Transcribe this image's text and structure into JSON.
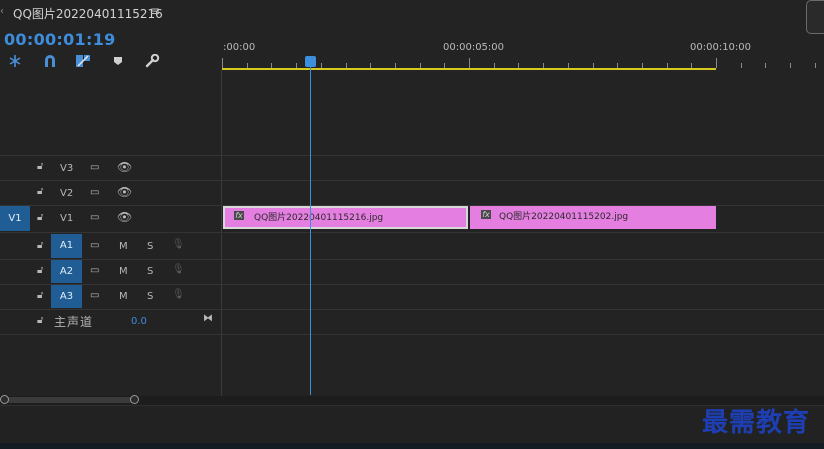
{
  "sequence": {
    "tab_title": "QQ图片20220401115216",
    "tab_arrow": "‹",
    "menu_icon": "≡",
    "timecode": "00:00:01:19"
  },
  "ruler": {
    "labels": [
      ":00:00",
      "00:00:05:00",
      "00:00:10:00"
    ]
  },
  "tracks": {
    "video": [
      {
        "name": "V3",
        "source_patch": ""
      },
      {
        "name": "V2",
        "source_patch": ""
      },
      {
        "name": "V1",
        "source_patch": "V1"
      }
    ],
    "audio": [
      {
        "name": "A1",
        "mute": "M",
        "solo": "S"
      },
      {
        "name": "A2",
        "mute": "M",
        "solo": "S"
      },
      {
        "name": "A3",
        "mute": "M",
        "solo": "S"
      }
    ],
    "master": {
      "label": "主声道",
      "value": "0.0"
    }
  },
  "clips": [
    {
      "name": "QQ图片20220401115216.jpg",
      "fx": "fx"
    },
    {
      "name": "QQ图片20220401115202.jpg",
      "fx": "fx"
    }
  ],
  "colors": {
    "accent": "#3b8fdd",
    "clip": "#e47ee0",
    "work_area": "#d5c91f"
  },
  "watermark": "最需教育"
}
